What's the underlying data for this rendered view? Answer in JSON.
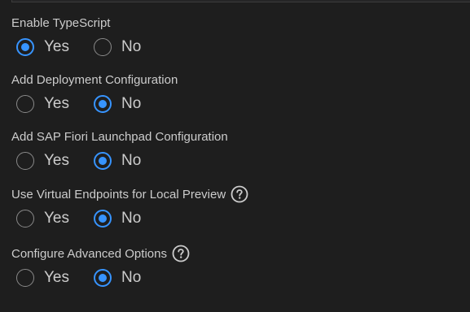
{
  "questions": [
    {
      "label": "Enable TypeScript",
      "help": false,
      "options": [
        "Yes",
        "No"
      ],
      "selected": "Yes"
    },
    {
      "label": "Add Deployment Configuration",
      "help": false,
      "options": [
        "Yes",
        "No"
      ],
      "selected": "No"
    },
    {
      "label": "Add SAP Fiori Launchpad Configuration",
      "help": false,
      "options": [
        "Yes",
        "No"
      ],
      "selected": "No"
    },
    {
      "label": "Use Virtual Endpoints for Local Preview",
      "help": true,
      "options": [
        "Yes",
        "No"
      ],
      "selected": "No"
    },
    {
      "label": "Configure Advanced Options",
      "help": true,
      "options": [
        "Yes",
        "No"
      ],
      "selected": "No"
    }
  ],
  "icons": {
    "help": "question-circle-icon"
  },
  "colors": {
    "background": "#1e1e1e",
    "text": "#cccccc",
    "accent": "#3794ff",
    "radio_border": "#8a8a8a"
  }
}
